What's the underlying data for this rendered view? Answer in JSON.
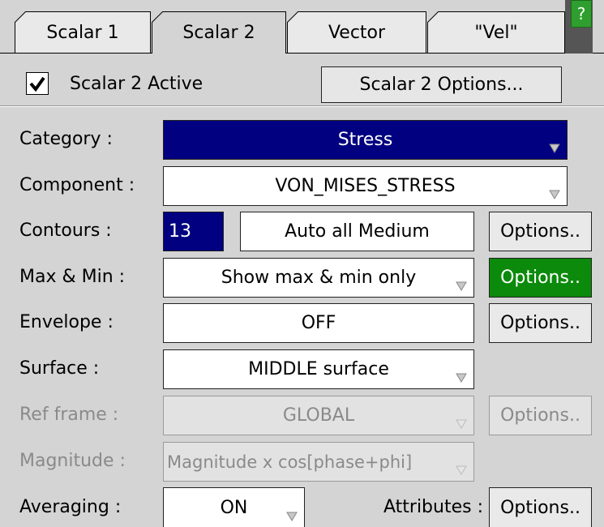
{
  "tabs": [
    {
      "label": "Scalar 1",
      "active": false
    },
    {
      "label": "Scalar 2",
      "active": true
    },
    {
      "label": "Vector",
      "active": false
    },
    {
      "label": "\"Vel\"",
      "active": false
    }
  ],
  "help_label": "?",
  "scalar_active": {
    "label": "Scalar 2 Active",
    "checked": true
  },
  "scalar_options_button": "Scalar 2 Options...",
  "rows": {
    "category": {
      "label": "Category :",
      "value": "Stress"
    },
    "component": {
      "label": "Component :",
      "value": "VON_MISES_STRESS"
    },
    "contours": {
      "label": "Contours :",
      "count": "13",
      "mode": "Auto all Medium",
      "options": "Options.."
    },
    "maxmin": {
      "label": "Max & Min :",
      "value": "Show max & min only",
      "options": "Options.."
    },
    "envelope": {
      "label": "Envelope :",
      "value": "OFF",
      "options": "Options.."
    },
    "surface": {
      "label": "Surface :",
      "value": "MIDDLE surface"
    },
    "ref_frame": {
      "label": "Ref frame :",
      "value": "GLOBAL",
      "options": "Options.."
    },
    "magnitude": {
      "label": "Magnitude :",
      "value": "Magnitude x cos[phase+phi]"
    },
    "averaging": {
      "label": "Averaging :",
      "value": "ON",
      "attributes_label": "Attributes :",
      "options": "Options.."
    }
  },
  "colors": {
    "selected_field": "#000080",
    "active_options": "#0b8a0b",
    "help": "#2e9e2e"
  }
}
